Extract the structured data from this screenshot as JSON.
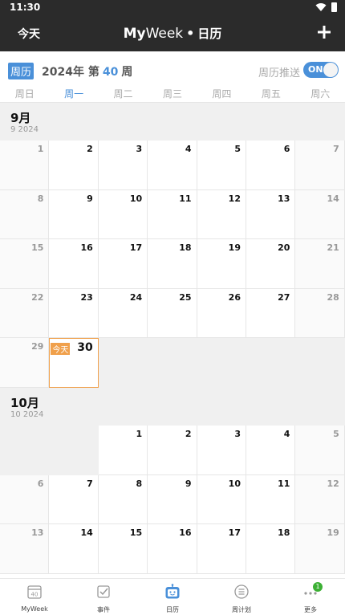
{
  "status": {
    "time": "11:30"
  },
  "header": {
    "today_label": "今天",
    "title_my": "My",
    "title_week": "Week",
    "title_dot": "•",
    "title_section": "日历"
  },
  "weekbar": {
    "badge": "周历",
    "label_pre": "2024年 第",
    "week_num": "40",
    "label_post": "周",
    "push_label": "周历推送",
    "toggle_text": "ON"
  },
  "weekdays": [
    "周日",
    "周一",
    "周二",
    "周三",
    "周四",
    "周五",
    "周六"
  ],
  "months": [
    {
      "name": "9月",
      "sub": "9 2024",
      "rows": [
        [
          "1",
          "2",
          "3",
          "4",
          "5",
          "6",
          "7"
        ],
        [
          "8",
          "9",
          "10",
          "11",
          "12",
          "13",
          "14"
        ],
        [
          "15",
          "16",
          "17",
          "18",
          "19",
          "20",
          "21"
        ],
        [
          "22",
          "23",
          "24",
          "25",
          "26",
          "27",
          "28"
        ],
        [
          "29",
          "30",
          "",
          "",
          "",
          "",
          ""
        ]
      ]
    },
    {
      "name": "10月",
      "sub": "10 2024",
      "rows": [
        [
          "",
          "",
          "1",
          "2",
          "3",
          "4",
          "5"
        ],
        [
          "6",
          "7",
          "8",
          "9",
          "10",
          "11",
          "12"
        ],
        [
          "13",
          "14",
          "15",
          "16",
          "17",
          "18",
          "19"
        ]
      ]
    }
  ],
  "today_tag": "今天",
  "tabs": [
    {
      "label": "MyWeek",
      "icon": "calendar-40-icon"
    },
    {
      "label": "事件",
      "icon": "checkbox-icon"
    },
    {
      "label": "日历",
      "icon": "robot-calendar-icon"
    },
    {
      "label": "周计划",
      "icon": "list-icon"
    },
    {
      "label": "更多",
      "icon": "more-dots-icon",
      "badge": "1"
    }
  ],
  "tab_icon_text": "40",
  "colors": {
    "accent": "#4a90d9",
    "today": "#f0a04b",
    "badge_green": "#3cb034",
    "topbar": "#2b2b2b"
  }
}
